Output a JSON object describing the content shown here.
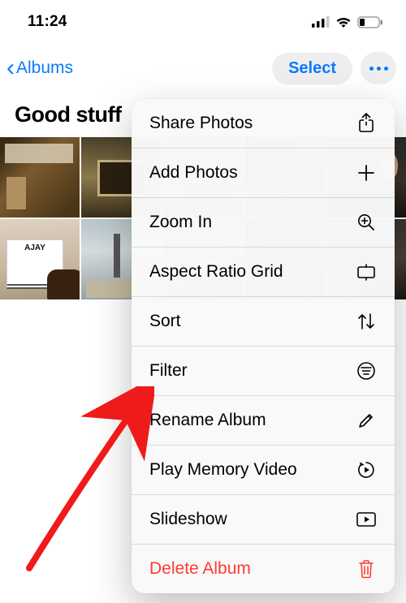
{
  "status": {
    "time": "11:24"
  },
  "nav": {
    "back_label": "Albums",
    "select_label": "Select"
  },
  "album": {
    "title": "Good stuff"
  },
  "menu": {
    "share": "Share Photos",
    "add": "Add Photos",
    "zoom": "Zoom In",
    "aspect": "Aspect Ratio Grid",
    "sort": "Sort",
    "filter": "Filter",
    "rename": "Rename Album",
    "memory": "Play Memory Video",
    "slideshow": "Slideshow",
    "delete": "Delete Album"
  },
  "colors": {
    "tint": "#0a7aff",
    "destructive": "#ff3b30"
  }
}
